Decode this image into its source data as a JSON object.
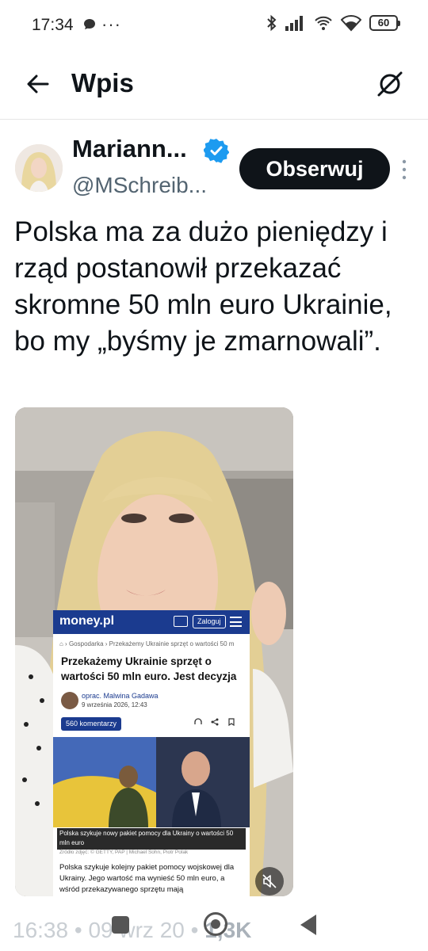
{
  "status_bar": {
    "time": "17:34",
    "overflow": "···",
    "battery": "60",
    "icons": [
      "chat-bubble-icon",
      "bluetooth-icon",
      "signal-icon",
      "wifi-call-icon",
      "wifi-icon",
      "battery-icon"
    ]
  },
  "header": {
    "title": "Wpis",
    "back_icon": "arrow-left-icon",
    "grok_icon": "grok-icon"
  },
  "author": {
    "name": "Mariann...",
    "handle": "@MSchreib...",
    "verified_color": "#1d9bf0",
    "follow_label": "Obserwuj"
  },
  "tweet": {
    "text": "Polska ma za dużo pieniędzy i rząd postanowił przekazać skromne 50 mln euro Ukrainie, bo my „byśmy je zmarnowali”."
  },
  "embedded_article": {
    "logo": "money.pl",
    "login_label": "Zaloguj",
    "breadcrumb": "⌂ › Gospodarka › Przekażemy Ukrainie sprzęt o wartości 50 m",
    "headline": "Przekażemy Ukrainie sprzęt o wartości 50 mln euro. Jest decyzja",
    "author_line": "oprac. Malwina Gadawa",
    "date": "9 września 2026, 12:43",
    "comments": "560 komentarzy",
    "caption": "Polska szykuje nowy pakiet pomocy dla Ukrainy o wartości 50 mln euro",
    "source": "Źródło zdjęć: © GETTY, PAP | Michael Sohn, Piotr Polak",
    "body": "Polska szykuje kolejny pakiet pomocy wojskowej dla Ukrainy. Jego wartość ma wynieść 50 mln euro, a wśród przekazywanego sprzętu mają",
    "brand_color": "#1b3b8f"
  },
  "media": {
    "mute_icon": "muted-speaker-icon"
  },
  "bottom": {
    "time": "16:38",
    "separator": "•",
    "date": "09 wrz 20",
    "views": "1,3K"
  },
  "navbar": {
    "icons": [
      "recent-apps-icon",
      "home-icon",
      "back-triangle-icon"
    ]
  }
}
